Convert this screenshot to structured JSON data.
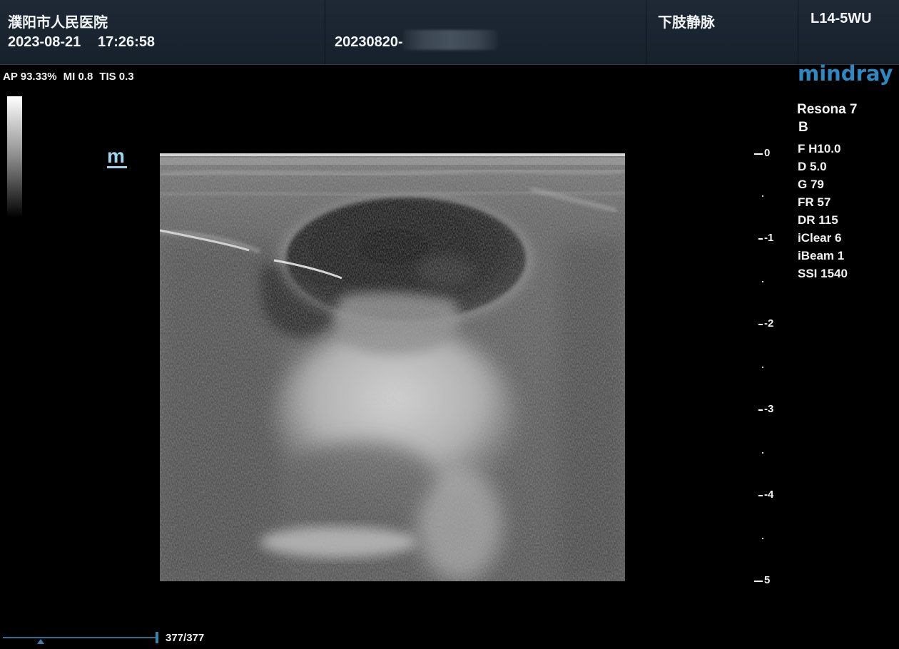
{
  "header": {
    "hospital": "濮阳市人民医院",
    "date": "2023-08-21",
    "time": "17:26:58",
    "patient_id": "20230820-",
    "exam": "下肢静脉",
    "probe": "L14-5WU"
  },
  "acoustic": {
    "ap": "AP 93.33%",
    "mi": "MI 0.8",
    "tis": "TIS 0.3"
  },
  "orientation_mark": "m",
  "brand": {
    "logo": "mindray",
    "logo_color": "#2e89c3",
    "model": "Resona 7",
    "mode": "B"
  },
  "params": [
    "F H10.0",
    "D 5.0",
    "G 79",
    "FR 57",
    "DR 115",
    "iClear 6",
    "iBeam 1",
    "SSI 1540"
  ],
  "depth_scale": {
    "labels": [
      "0",
      "1",
      "2",
      "3",
      "4",
      "5"
    ],
    "max_cm": 5
  },
  "cine": {
    "frame": "377/377",
    "progress": 1.0
  },
  "colors": {
    "header_bg": "#1e2935",
    "orientation_mark": "#9fd4ee",
    "cine": "#3a82aa"
  }
}
